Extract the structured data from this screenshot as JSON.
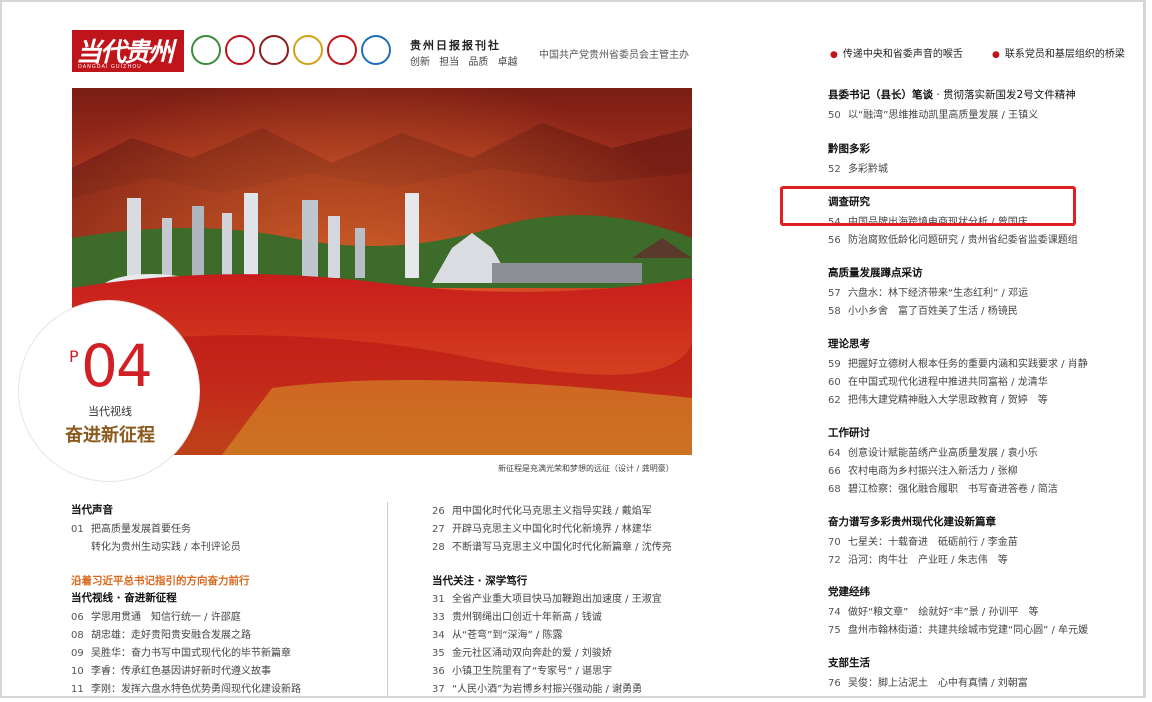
{
  "masthead": {
    "logo_text": "当代贵州",
    "logo_subtext": "DANGDAI GUIZHOU",
    "badges": [
      {
        "name": "badge-1-icon",
        "color": "#3a8b3a"
      },
      {
        "name": "badge-2-icon",
        "color": "#c0141b"
      },
      {
        "name": "badge-3-icon",
        "color": "#8b1d1d"
      },
      {
        "name": "badge-4-icon",
        "color": "#d4a017"
      },
      {
        "name": "badge-5-icon",
        "color": "#c0141b"
      },
      {
        "name": "badge-6-icon",
        "color": "#1d6fb8"
      }
    ],
    "publisher_title": "贵州日报报刊社",
    "publisher_motto": "创新 担当 品质 卓越",
    "publisher_host": "中国共产党贵州省委员会主管主办",
    "slogan_1": "传递中央和省委声音的喉舌",
    "slogan_2": "联系党员和基层组织的桥梁"
  },
  "hero": {
    "caption": "新征程是充满光荣和梦想的远征（设计 / 龚明豪）",
    "page_prefix": "P",
    "page_number": "04",
    "section_sub": "当代视线",
    "section_main": "奋进新征程"
  },
  "toc_left": {
    "sec1_title": "当代声音",
    "sec1_items": [
      {
        "num": "01",
        "text": "把高质量发展首要任务"
      },
      {
        "num": "",
        "text": "转化为贵州生动实践 / 本刊评论员"
      }
    ],
    "banner": "沿着习近平总书记指引的方向奋力前行",
    "sec2_title": "当代视线 · 奋进新征程",
    "sec2_items": [
      {
        "num": "06",
        "text": "学思用贯通　知信行统一 / 许邵庭"
      },
      {
        "num": "08",
        "text": "胡忠雄：走好贵阳贵安融合发展之路"
      },
      {
        "num": "09",
        "text": "吴胜华：奋力书写中国式现代化的毕节新篇章"
      },
      {
        "num": "10",
        "text": "李睿：传承红色基因讲好新时代遵义故事"
      },
      {
        "num": "11",
        "text": "李刚：发挥六盘水特色优势勇闯现代化建设新路"
      }
    ]
  },
  "toc_mid": {
    "items_top": [
      {
        "num": "26",
        "text": "用中国化时代化马克思主义指导实践 / 戴焰军"
      },
      {
        "num": "27",
        "text": "开辟马克思主义中国化时代化新境界 / 林建华"
      },
      {
        "num": "28",
        "text": "不断谱写马克思主义中国化时代化新篇章 / 沈传亮"
      }
    ],
    "sec_title": "当代关注 · 深学笃行",
    "items": [
      {
        "num": "31",
        "text": "全省产业重大项目快马加鞭跑出加速度 / 王淑宜"
      },
      {
        "num": "33",
        "text": "贵州钢绳出口创近十年新高 / 钱诚"
      },
      {
        "num": "34",
        "text": "从“苍弯”到“深海” / 陈露"
      },
      {
        "num": "35",
        "text": "金元社区涌动双向奔赴的爱 / 刘骏娇"
      },
      {
        "num": "36",
        "text": "小镇卫生院里有了“专家号” / 谌思宇"
      },
      {
        "num": "37",
        "text": "“人民小酒”为岩博乡村振兴强动能 / 谢勇勇"
      }
    ]
  },
  "toc_right": [
    {
      "title": "县委书记（县长）笔谈",
      "title_suffix": " · 贯彻落实新国发2号文件精神",
      "items": [
        {
          "num": "50",
          "text": "以“融湾”思维推动凯里高质量发展 / 王镇义"
        }
      ]
    },
    {
      "title": "黔图多彩",
      "items": [
        {
          "num": "52",
          "text": "多彩黔城"
        }
      ]
    },
    {
      "title": "调查研究",
      "items": [
        {
          "num": "54",
          "text": "中国品牌出海跨境电商现状分析 / 曾国庆"
        },
        {
          "num": "56",
          "text": "防治腐败低龄化问题研究 / 贵州省纪委省监委课题组"
        }
      ]
    },
    {
      "title": "高质量发展蹲点采访",
      "items": [
        {
          "num": "57",
          "text": "六盘水：林下经济带来“生态红利” / 邓运"
        },
        {
          "num": "58",
          "text": "小小乡舍　富了百姓美了生活 / 杨镜民"
        }
      ]
    },
    {
      "title": "理论思考",
      "items": [
        {
          "num": "59",
          "text": "把握好立德树人根本任务的重要内涵和实践要求 / 肖静"
        },
        {
          "num": "60",
          "text": "在中国式现代化进程中推进共同富裕 / 龙清华"
        },
        {
          "num": "62",
          "text": "把伟大建党精神融入大学思政教育 / 贺婷　等"
        }
      ]
    },
    {
      "title": "工作研讨",
      "items": [
        {
          "num": "64",
          "text": "创意设计赋能苗绣产业高质量发展 / 袁小乐"
        },
        {
          "num": "66",
          "text": "农村电商为乡村振兴注入新活力 / 张柳"
        },
        {
          "num": "68",
          "text": "碧江检察：强化融合履职　书写奋进答卷 / 简洁"
        }
      ]
    },
    {
      "title": "奋力谱写多彩贵州现代化建设新篇章",
      "items": [
        {
          "num": "70",
          "text": "七星关：十载奋进　砥砺前行 / 李金苗"
        },
        {
          "num": "72",
          "text": "沿河：肉牛壮　产业旺 / 朱志伟　等"
        }
      ]
    },
    {
      "title": "党建经纬",
      "items": [
        {
          "num": "74",
          "text": "做好“粮文章”　绘就好“丰”景 / 孙训平　等"
        },
        {
          "num": "75",
          "text": "盘州市翰林街道：共建共绘城市党建“同心圆” / 牟元媛"
        }
      ]
    },
    {
      "title": "支部生活",
      "items": [
        {
          "num": "76",
          "text": "吴俊：脚上沾泥土　心中有真情 / 刘朝富"
        }
      ]
    }
  ],
  "colors": {
    "accent": "#c0141b",
    "highlight_box": "#e02020",
    "banner": "#d9691e",
    "page_number": "#d11f26",
    "title_gold": "#8b5a1c"
  }
}
